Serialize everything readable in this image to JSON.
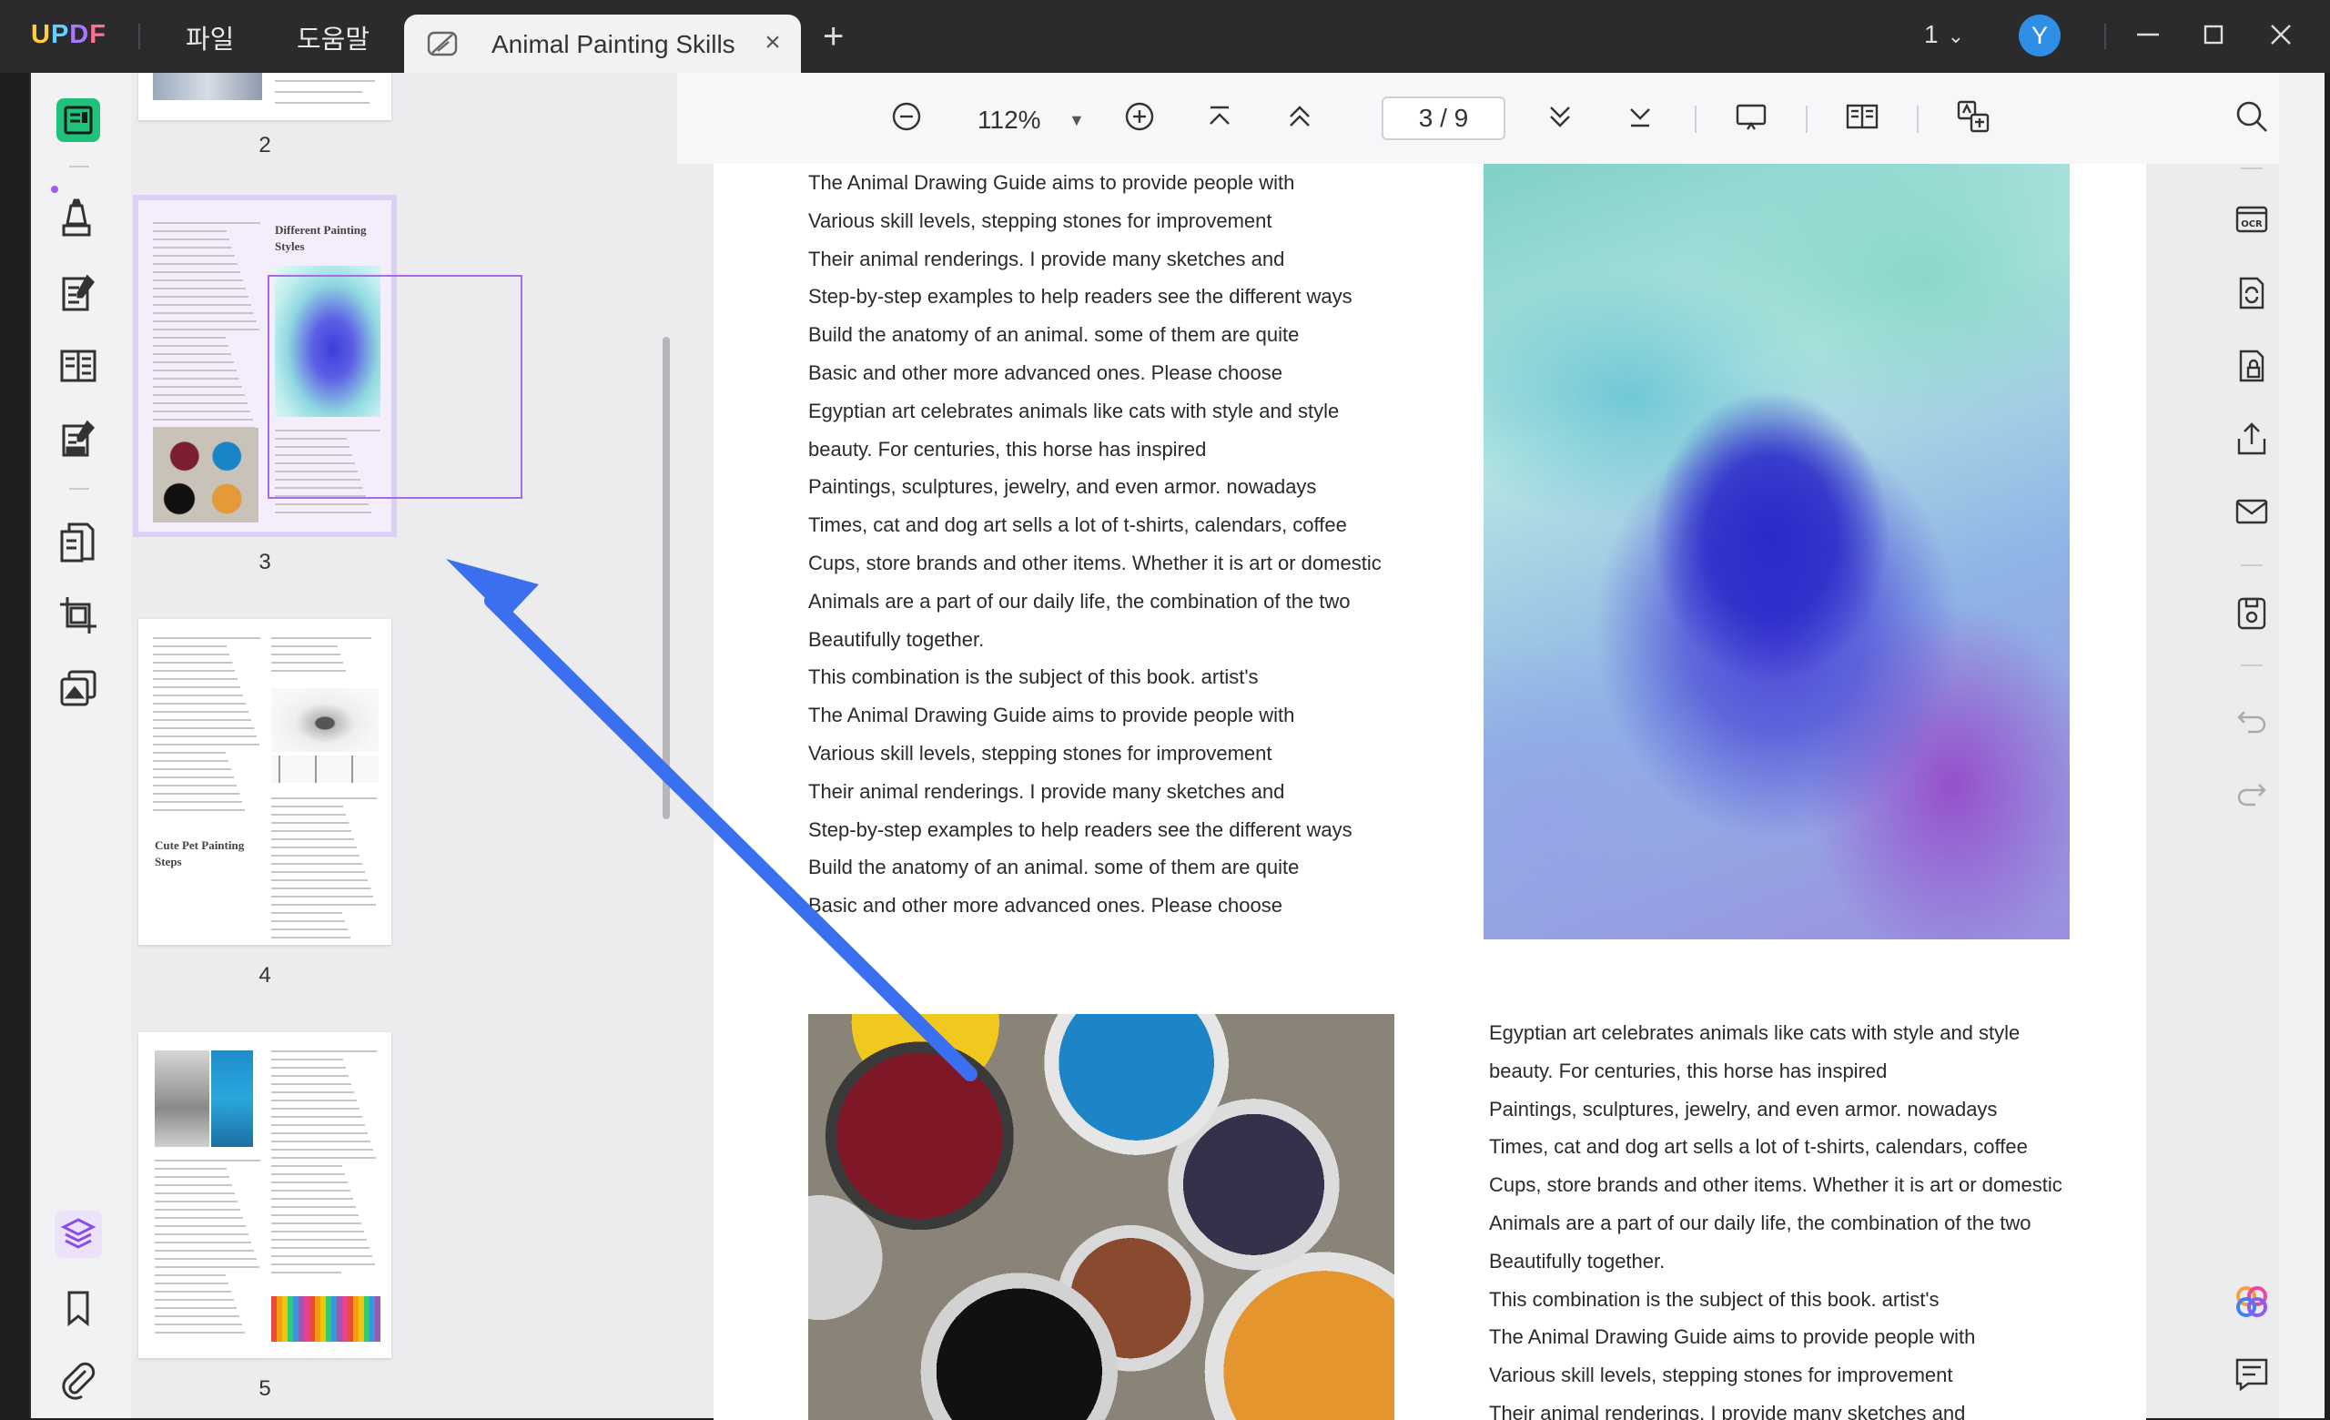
{
  "app": {
    "logo": "UPDF",
    "menu": [
      "파일",
      "도움말"
    ],
    "tab_title": "Animal Painting Skills",
    "tab_close": "×",
    "new_tab": "+",
    "window_count": "1",
    "avatar_initial": "Y"
  },
  "toolbar": {
    "zoom": "112%",
    "page_indicator": "3 / 9"
  },
  "thumbnails": [
    {
      "num": "2"
    },
    {
      "num": "3",
      "heading": "Different Painting Styles",
      "selected": true
    },
    {
      "num": "4",
      "heading": "Cute Pet Painting Steps"
    },
    {
      "num": "5"
    }
  ],
  "document": {
    "left_column": [
      "The Animal Drawing Guide aims to provide people with",
      "Various skill levels, stepping stones for improvement",
      "Their animal renderings. I provide many sketches and",
      "Step-by-step examples to help readers see the different ways",
      "Build the anatomy of an animal. some of them are quite",
      "Basic and other more advanced ones. Please choose",
      "Egyptian art celebrates animals like cats with style and style",
      "beauty. For centuries, this horse has inspired",
      "Paintings, sculptures, jewelry, and even armor. nowadays",
      "Times, cat and dog art sells a lot of t-shirts, calendars, coffee",
      "Cups, store brands and other items. Whether it is art or domestic",
      "Animals are a part of our daily life, the combination of the two",
      "Beautifully together.",
      "This combination is the subject of this book. artist's",
      "The Animal Drawing Guide aims to provide people with",
      "Various skill levels, stepping stones for improvement",
      "Their animal renderings. I provide many sketches and",
      "Step-by-step examples to help readers see the different ways",
      "Build the anatomy of an animal. some of them are quite",
      "Basic and other more advanced ones. Please choose"
    ],
    "right_column": [
      "Egyptian art celebrates animals like cats with style and style",
      "beauty. For centuries, this horse has inspired",
      "Paintings, sculptures, jewelry, and even armor. nowadays",
      "Times, cat and dog art sells a lot of t-shirts, calendars, coffee",
      "Cups, store brands and other items. Whether it is art or domestic",
      "Animals are a part of our daily life, the combination of the two",
      "Beautifully together.",
      "This combination is the subject of this book. artist's",
      "The Animal Drawing Guide aims to provide people with",
      "Various skill levels, stepping stones for improvement",
      "Their animal renderings. I provide many sketches and"
    ]
  },
  "colors": {
    "accent": "#a86ae8",
    "arrow": "#3a6ff0",
    "titlebar": "#2b2b2e",
    "avatar": "#2f8fe6"
  },
  "icons": {
    "left_rail": [
      "reader-icon",
      "comment-icon",
      "edit-icon",
      "form-icon",
      "fill-sign-icon",
      "organize-pages-icon",
      "crop-icon",
      "page-tools-icon",
      "layers-icon",
      "bookmark-icon",
      "attachment-icon"
    ],
    "right_rail": [
      "search-icon",
      "ocr-icon",
      "convert-icon",
      "protect-icon",
      "share-icon",
      "email-icon",
      "save-icon",
      "undo-icon",
      "redo-icon",
      "ai-assistant-icon",
      "comments-icon"
    ]
  }
}
